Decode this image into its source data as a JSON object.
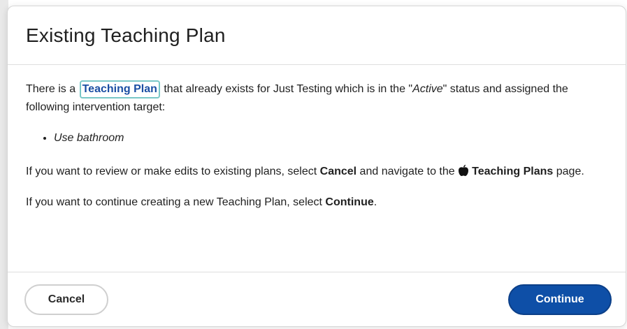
{
  "dialog": {
    "title": "Existing Teaching Plan",
    "intro_before": "There is a ",
    "link_label": "Teaching Plan",
    "intro_mid": " that already exists for Just Testing which is in the \"",
    "status": "Active",
    "intro_after": "\" status and assigned the following intervention target:",
    "targets": [
      "Use bathroom"
    ],
    "review_before": "If you want to review or make edits to existing plans, select ",
    "review_cancel_word": "Cancel",
    "review_mid": " and navigate to the ",
    "review_page_name": "Teaching Plans",
    "review_after": " page.",
    "continue_before": "If you want to continue creating a new Teaching Plan, select ",
    "continue_word": "Continue",
    "continue_after": "."
  },
  "footer": {
    "cancel_label": "Cancel",
    "continue_label": "Continue"
  },
  "icons": {
    "page_icon": "apple-icon"
  },
  "colors": {
    "primary": "#0e4fa7",
    "link": "#1a4ea3",
    "focus_ring": "#79c7c7"
  }
}
